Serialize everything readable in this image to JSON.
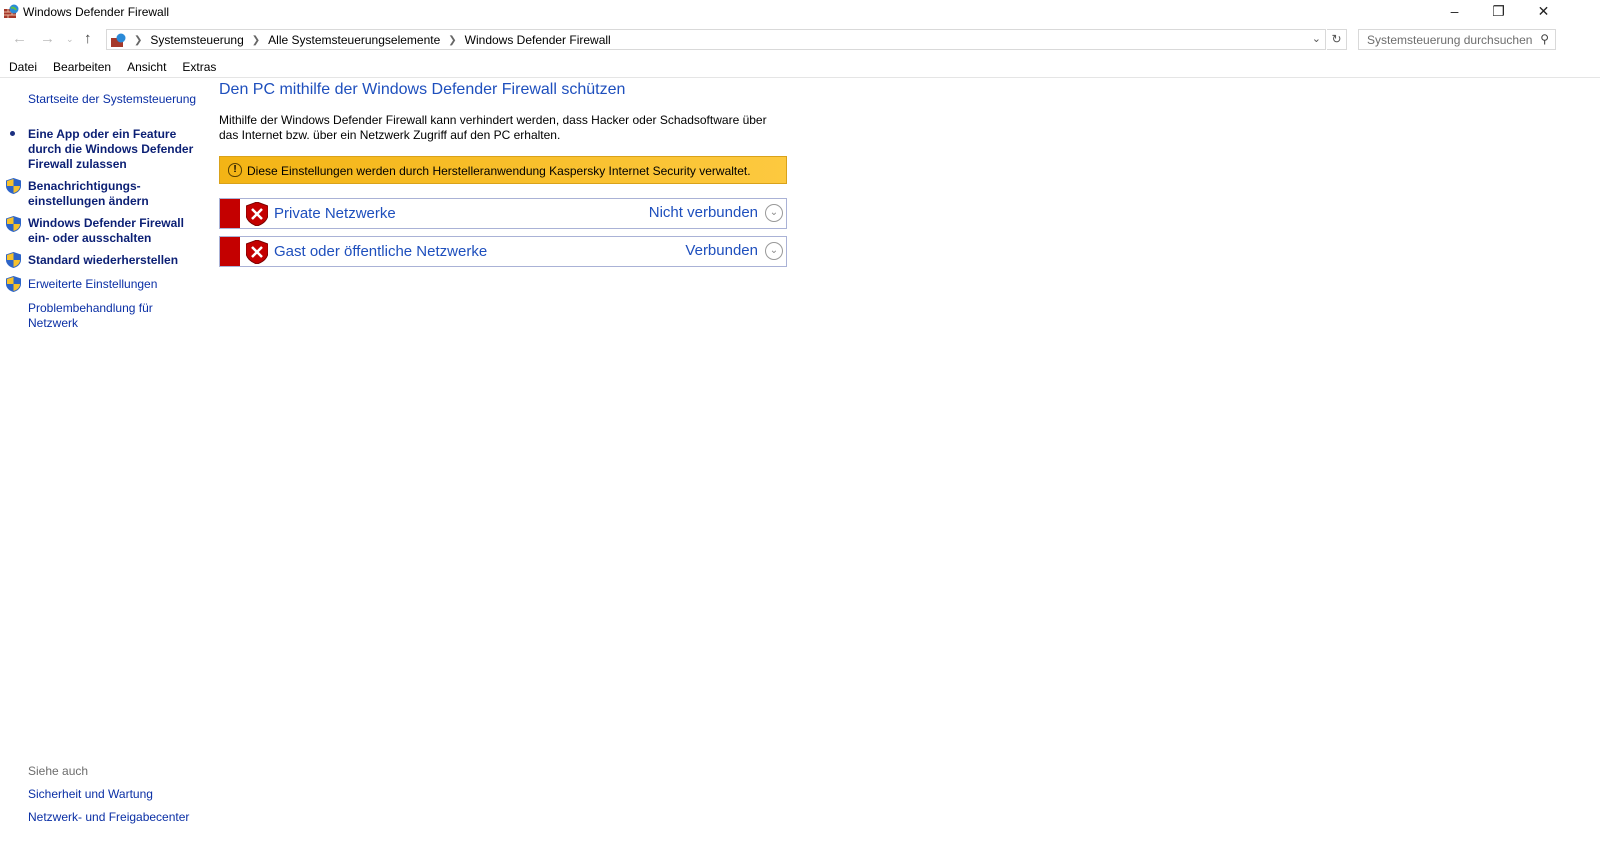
{
  "window": {
    "title": "Windows Defender Firewall"
  },
  "address": {
    "crumbs": [
      "Systemsteuerung",
      "Alle Systemsteuerungselemente",
      "Windows Defender Firewall"
    ],
    "search_placeholder": "Systemsteuerung durchsuchen"
  },
  "menu": [
    "Datei",
    "Bearbeiten",
    "Ansicht",
    "Extras"
  ],
  "sidebar": {
    "home": "Startseite der Systemsteuerung",
    "items": [
      {
        "label": "Eine App oder ein Feature durch die Windows Defender Firewall zulassen",
        "icon": "bullet"
      },
      {
        "label": "Benachrichtigungs-einstellungen ändern",
        "icon": "uac-shield-icon"
      },
      {
        "label": "Windows Defender Firewall ein- oder ausschalten",
        "icon": "uac-shield-icon"
      },
      {
        "label": "Standard wiederherstellen",
        "icon": "uac-shield-icon"
      },
      {
        "label": "Erweiterte Einstellungen",
        "icon": "uac-shield-icon"
      },
      {
        "label": "Problembehandlung für Netzwerk",
        "icon": "none"
      }
    ],
    "see_also": "Siehe auch",
    "see_also_links": [
      "Sicherheit und Wartung",
      "Netzwerk- und Freigabecenter"
    ]
  },
  "main": {
    "heading": "Den PC mithilfe der Windows Defender Firewall schützen",
    "description": "Mithilfe der Windows Defender Firewall kann verhindert werden, dass Hacker oder Schadsoftware über das Internet bzw. über ein Netzwerk Zugriff auf den PC erhalten.",
    "warning": "Diese Einstellungen werden durch Herstelleranwendung Kaspersky Internet Security verwaltet.",
    "networks": [
      {
        "name": "Private Netzwerke",
        "status": "Nicht verbunden"
      },
      {
        "name": "Gast oder öffentliche Netzwerke",
        "status": "Verbunden"
      }
    ]
  },
  "colors": {
    "accent": "#1e4fbd",
    "warning": "#fdc93f",
    "danger": "#c40000"
  }
}
